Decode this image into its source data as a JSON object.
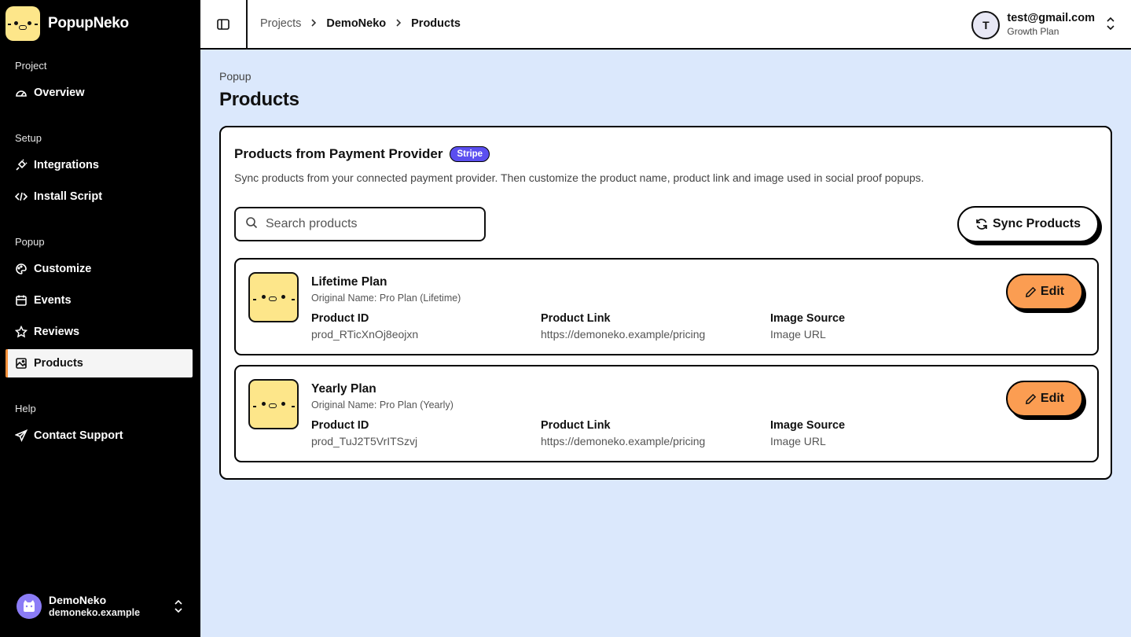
{
  "app": {
    "name": "PopupNeko"
  },
  "sidebar": {
    "sections": [
      {
        "label": "Project"
      },
      {
        "label": "Setup"
      },
      {
        "label": "Popup"
      },
      {
        "label": "Help"
      }
    ],
    "items": [
      {
        "label": "Overview",
        "icon": "gauge-icon"
      },
      {
        "label": "Integrations",
        "icon": "plug-icon"
      },
      {
        "label": "Install Script",
        "icon": "code-icon"
      },
      {
        "label": "Customize",
        "icon": "palette-icon"
      },
      {
        "label": "Events",
        "icon": "calendar-icon"
      },
      {
        "label": "Reviews",
        "icon": "star-icon"
      },
      {
        "label": "Products",
        "icon": "image-icon",
        "active": true
      },
      {
        "label": "Contact Support",
        "icon": "send-icon"
      }
    ],
    "footer": {
      "name": "DemoNeko",
      "domain": "demoneko.example"
    }
  },
  "header": {
    "breadcrumb": [
      "Projects",
      "DemoNeko",
      "Products"
    ],
    "user": {
      "initial": "T",
      "email": "test@gmail.com",
      "plan": "Growth Plan"
    }
  },
  "page": {
    "subtitle": "Popup",
    "title": "Products"
  },
  "card": {
    "title": "Products from Payment Provider",
    "badge": "Stripe",
    "description": "Sync products from your connected payment provider. Then customize the product name, product link and image used in social proof popups.",
    "search_placeholder": "Search products",
    "sync_label": "Sync Products",
    "edit_label": "Edit",
    "col_labels": {
      "id": "Product ID",
      "link": "Product Link",
      "source": "Image Source"
    },
    "products": [
      {
        "name": "Lifetime Plan",
        "original": "Original Name: Pro Plan (Lifetime)",
        "id": "prod_RTicXnOj8eojxn",
        "link": "https://demoneko.example/pricing",
        "source": "Image URL"
      },
      {
        "name": "Yearly Plan",
        "original": "Original Name: Pro Plan (Yearly)",
        "id": "prod_TuJ2T5VrITSzvj",
        "link": "https://demoneko.example/pricing",
        "source": "Image URL"
      }
    ]
  },
  "colors": {
    "accent": "#fb9d52",
    "badge": "#5b4ff0",
    "background": "#dbe8fc",
    "logo": "#fde68a"
  }
}
